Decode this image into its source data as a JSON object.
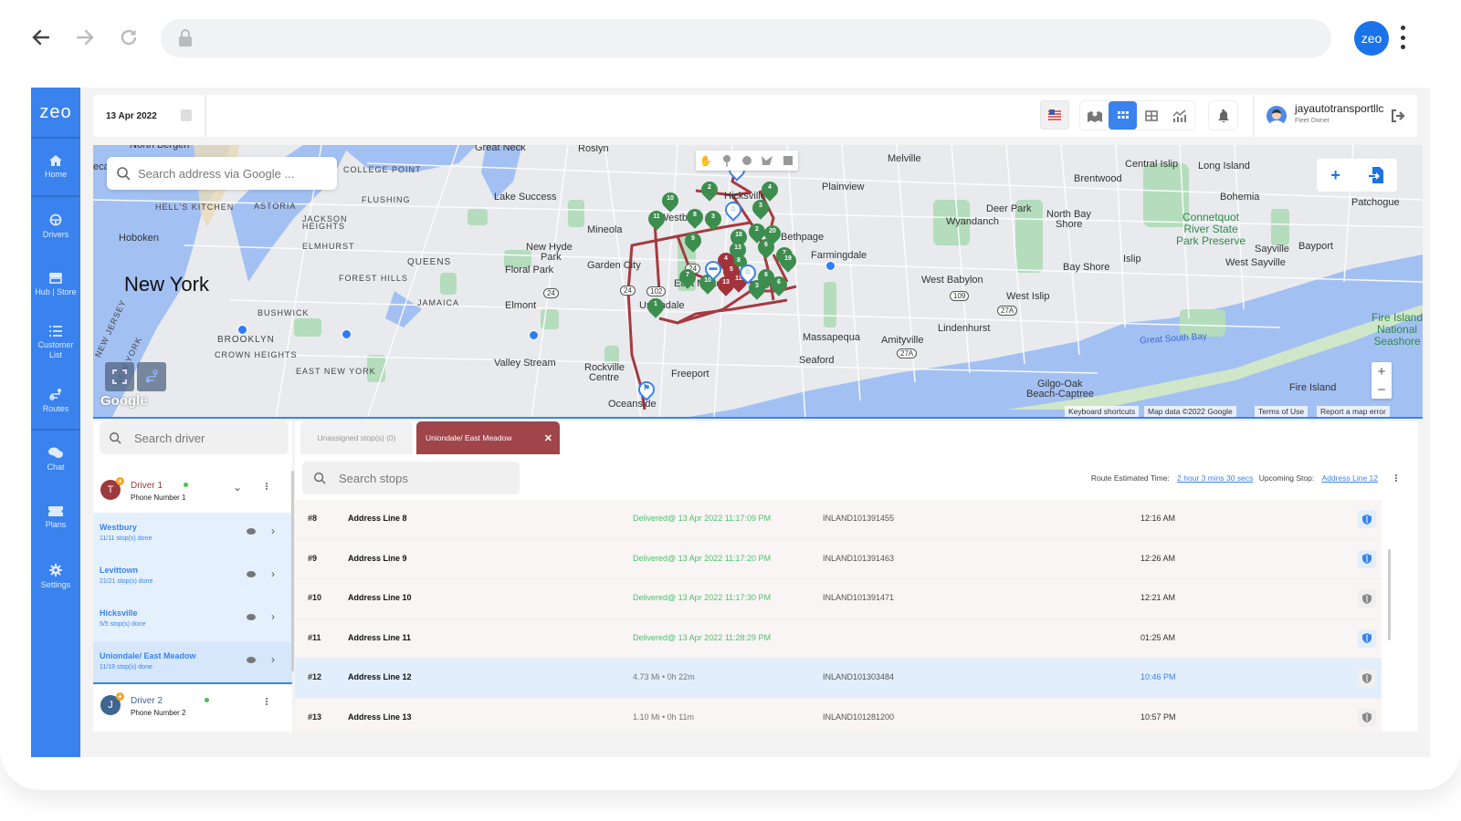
{
  "browser": {
    "profile_label": "zeo"
  },
  "app": {
    "logo": "zeo",
    "sidebar": [
      {
        "label": "Home",
        "icon": "home-icon"
      },
      {
        "label": "Drivers",
        "icon": "steering-wheel-icon"
      },
      {
        "label": "Hub | Store",
        "icon": "store-icon"
      },
      {
        "label": "Customer List",
        "icon": "list-icon"
      },
      {
        "label": "Routes",
        "icon": "route-icon"
      },
      {
        "label": "Chat",
        "icon": "chat-icon"
      },
      {
        "label": "Plans",
        "icon": "ticket-icon"
      },
      {
        "label": "Settings",
        "icon": "gear-icon"
      }
    ],
    "topbar": {
      "date": "13 Apr 2022",
      "username": "jayautotransportllc",
      "role": "Fleet Owner",
      "active_view": "grid"
    }
  },
  "map": {
    "search_placeholder": "Search address via Google ...",
    "labels": {
      "new_york": "New York",
      "north_bergen": "North Bergen",
      "secaucus": "ecau",
      "hells_kitchen": "HELL'S KITCHEN",
      "astoria": "ASTORIA",
      "hoboken": "Hoboken",
      "jackson": "JACKSON",
      "heights": "HEIGHTS",
      "elmhurst": "ELMHURST",
      "queens": "QUEENS",
      "forest_hills": "FOREST HILLS",
      "jamaica": "JAMAICA",
      "bushwick": "BUSHWICK",
      "brooklyn": "BROOKLYN",
      "crown_heights": "CROWN HEIGHTS",
      "east_new_york": "EAST NEW YORK",
      "college_point": "COLLEGE POINT",
      "flushing": "FLUSHING",
      "new_jersey": "NEW JERSEY",
      "new_york_state": "NEW YORK",
      "great_neck": "Great Neck",
      "roslyn": "Roslyn",
      "lake_success": "Lake Success",
      "mineola": "Mineola",
      "new_hyde_park_1": "New Hyde",
      "new_hyde_park_2": "Park",
      "floral_park": "Floral Park",
      "garden_city": "Garden City",
      "elmont": "Elmont",
      "valley_stream": "Valley Stream",
      "rockville_1": "Rockville",
      "rockville_2": "Centre",
      "freeport": "Freeport",
      "oceanside": "Oceanside",
      "melville": "Melville",
      "plainview": "Plainview",
      "farmingdale": "Farmingdale",
      "bethpage": "Bethpage",
      "massapequa": "Massapequa",
      "amityville": "Amityville",
      "seaford": "Seaford",
      "west_babylon": "West Babylon",
      "lindenhurst": "Lindenhurst",
      "wyandanch": "Wyandanch",
      "deer_park": "Deer Park",
      "brentwood": "Brentwood",
      "central_islip": "Central Islip",
      "long_island": "Long Island",
      "bohemia": "Bohemia",
      "patchogue": "Patchogue",
      "north_bay_shore_1": "North Bay",
      "north_bay_shore_2": "Shore",
      "connetquot": "Connetquot\nRiver State\nPark Preserve",
      "sayville": "Sayville",
      "bayport": "Bayport",
      "west_sayville": "West Sayville",
      "bay_shore": "Bay Shore",
      "islip": "Islip",
      "west_islip": "West Islip",
      "great_south_bay": "Great South Bay",
      "fire_island": "Fire Island",
      "fire_island_nat": "Fire Island\nNational\nSeashore",
      "gilgo_1": "Gilgo-Oak",
      "gilgo_2": "Beach-Captree",
      "hicksville": "Hicksville",
      "westbury": "Westbury",
      "east_meadow": "East Meadow",
      "uniondale": "Uniondale"
    },
    "shields": [
      "24",
      "24",
      "102",
      "24",
      "109",
      "27A",
      "27A"
    ],
    "google_logo": "Google",
    "attribution": [
      "Keyboard shortcuts",
      "Map data ©2022 Google",
      "Terms of Use",
      "Report a map error"
    ],
    "green_pins": [
      "10",
      "2",
      "4",
      "3",
      "11",
      "8",
      "3",
      "9",
      "18",
      "2",
      "20",
      "13",
      "6",
      "8",
      "7",
      "19",
      "24",
      "6",
      "7",
      "10",
      "1",
      "3",
      "6"
    ],
    "red_pins": [
      "4",
      "5",
      "13",
      "12"
    ]
  },
  "drivers": {
    "search_placeholder": "Search driver",
    "list": [
      {
        "initial": "T",
        "name": "Driver 1",
        "phone": "Phone Number 1",
        "avatar_color": "#9b3b3e",
        "name_color": "#a0343a",
        "online": true,
        "routes": [
          {
            "name": "Westbury",
            "progress": "11/11 stop(s) done"
          },
          {
            "name": "Levittown",
            "progress": "21/21 stop(s) done"
          },
          {
            "name": "Hicksville",
            "progress": "5/5 stop(s) done"
          },
          {
            "name": "Uniondale/ East Meadow",
            "progress": "11/19 stop(s) done",
            "selected": true
          }
        ]
      },
      {
        "initial": "J",
        "name": "Driver 2",
        "phone": "Phone Number 2",
        "avatar_color": "#3f6690",
        "name_color": "#3f6690",
        "online": true
      }
    ]
  },
  "stops": {
    "tabs": [
      {
        "label": "Unassigned stop(s) (0)"
      },
      {
        "label": "Uniondale/ East Meadow",
        "active": true
      }
    ],
    "search_placeholder": "Search stops",
    "route_estimated_label": "Route Estimated Time:",
    "route_estimated_value": "2 hour 3 mins 30 secs",
    "upcoming_label": "Upcoming Stop:",
    "upcoming_value": "Address Line 12",
    "rows": [
      {
        "num": "#8",
        "address": "Address Line 8",
        "status": "Delivered@ 13 Apr 2022 11:17:09 PM",
        "delivered": true,
        "id": "INLAND101391455",
        "time": "12:16 AM",
        "shield": "blue"
      },
      {
        "num": "#9",
        "address": "Address Line 9",
        "status": "Delivered@ 13 Apr 2022 11:17:20 PM",
        "delivered": true,
        "id": "INLAND101391463",
        "time": "12:26 AM",
        "shield": "blue"
      },
      {
        "num": "#10",
        "address": "Address Line 10",
        "status": "Delivered@ 13 Apr 2022 11:17:30 PM",
        "delivered": true,
        "id": "INLAND101391471",
        "time": "12:21 AM",
        "shield": "grey"
      },
      {
        "num": "#11",
        "address": "Address Line 11",
        "status": "Delivered@ 13 Apr 2022 11:28:29 PM",
        "delivered": true,
        "id": "",
        "time": "01:25 AM",
        "shield": "blue"
      },
      {
        "num": "#12",
        "address": "Address Line 12",
        "status": "4.73 Mi • 0h 22m",
        "delivered": false,
        "id": "INLAND101303484",
        "time": "10:46 PM",
        "shield": "grey",
        "active": true
      },
      {
        "num": "#13",
        "address": "Address Line 13",
        "status": "1.10 Mi • 0h 11m",
        "delivered": false,
        "id": "INLAND101281200",
        "time": "10:57 PM",
        "shield": "grey"
      }
    ]
  }
}
